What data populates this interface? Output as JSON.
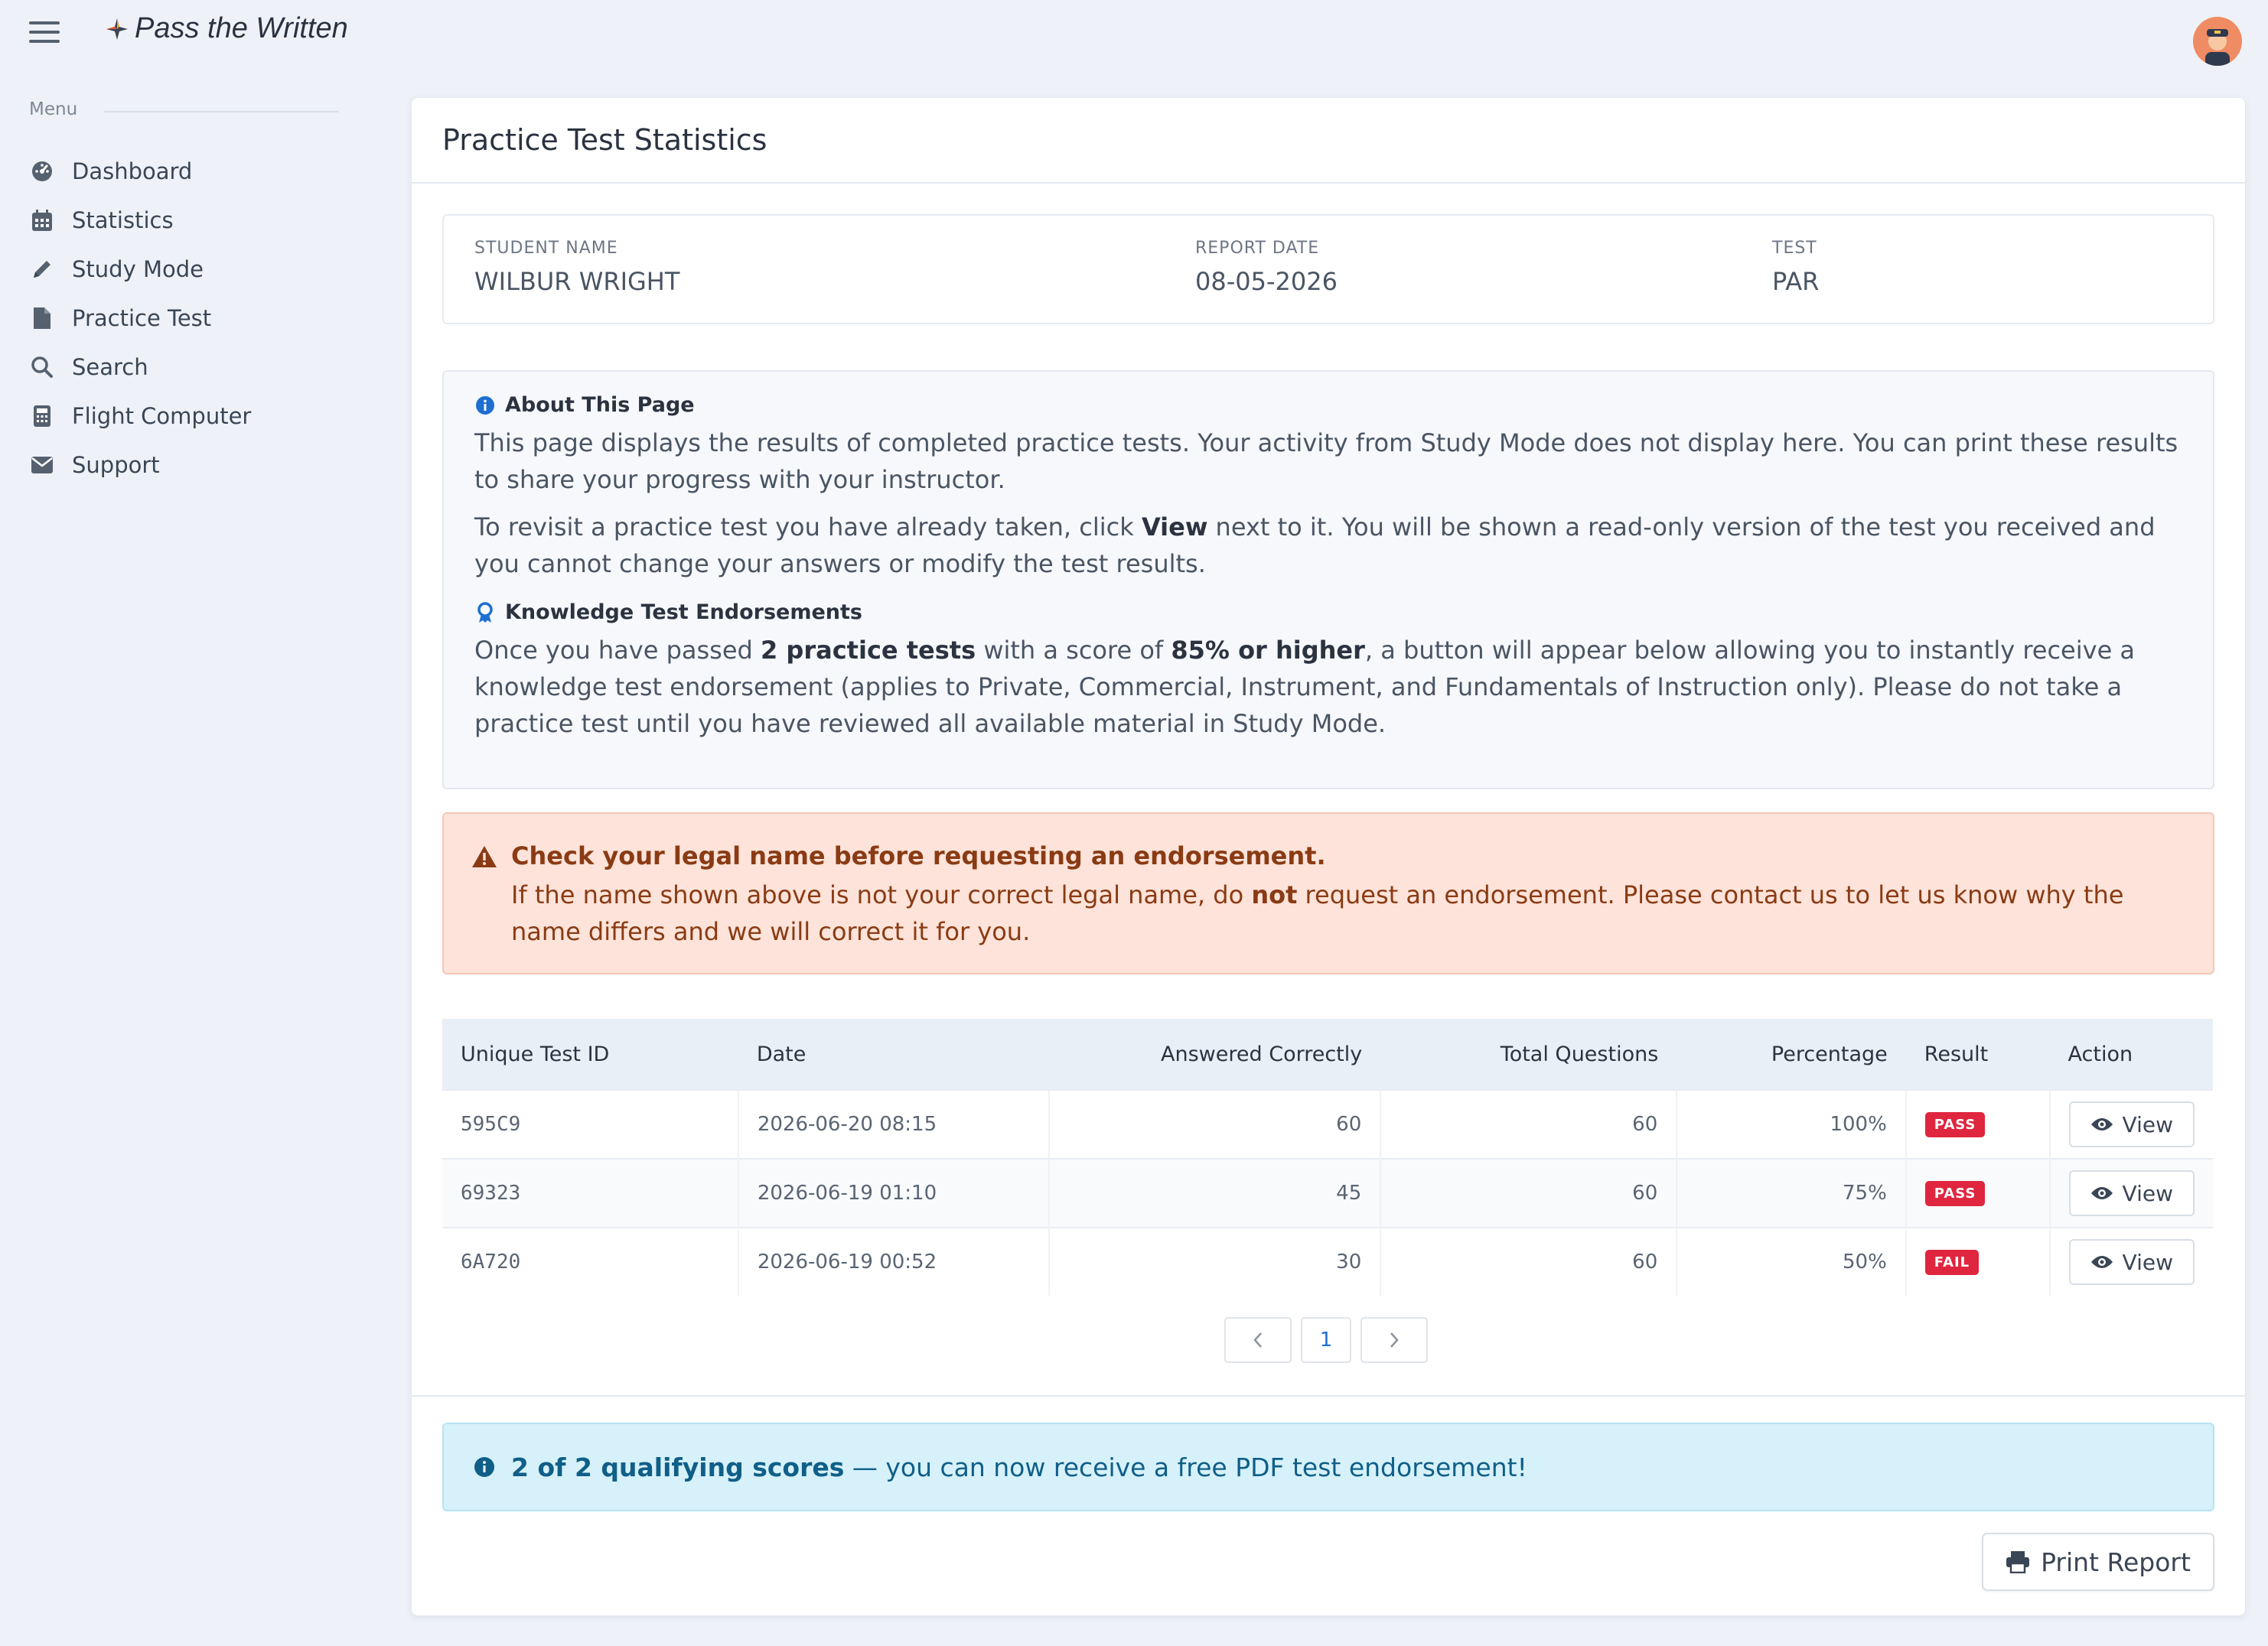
{
  "header": {
    "app_title": "Pass the Written"
  },
  "sidebar": {
    "section_label": "Menu",
    "items": [
      {
        "label": "Dashboard",
        "icon": "dashboard-icon"
      },
      {
        "label": "Statistics",
        "icon": "calendar-icon"
      },
      {
        "label": "Study Mode",
        "icon": "pencil-icon"
      },
      {
        "label": "Practice Test",
        "icon": "file-icon"
      },
      {
        "label": "Search",
        "icon": "search-icon"
      },
      {
        "label": "Flight Computer",
        "icon": "calculator-icon"
      },
      {
        "label": "Support",
        "icon": "envelope-icon"
      }
    ]
  },
  "page": {
    "title": "Practice Test Statistics"
  },
  "student": {
    "name_label": "STUDENT NAME",
    "name": "WILBUR WRIGHT",
    "date_label": "REPORT DATE",
    "date": "08-05-2026",
    "test_label": "TEST",
    "test": "PAR"
  },
  "about": {
    "heading": "About This Page",
    "p1": "This page displays the results of completed practice tests. Your activity from Study Mode does not display here. You can print these results to share your progress with your instructor.",
    "p2_a": "To revisit a practice test you have already taken, click ",
    "p2_b": "View",
    "p2_c": " next to it. You will be shown a read-only version of the test you received and you cannot change your answers or modify the test results.",
    "endorse_heading": "Knowledge Test Endorsements",
    "p3_a": "Once you have passed ",
    "p3_b": "2 practice tests",
    "p3_c": " with a score of ",
    "p3_d": "85% or higher",
    "p3_e": ", a button will appear below allowing you to instantly receive a knowledge test endorsement (applies to Private, Commercial, Instrument, and Fundamentals of Instruction only). Please do not take a practice test until you have reviewed all available material in Study Mode."
  },
  "warning": {
    "title": "Check your legal name before requesting an endorsement.",
    "body_a": "If the name shown above is not your correct legal name, do ",
    "body_b": "not",
    "body_c": " request an endorsement. Please contact us to let us know why the name differs and we will correct it for you."
  },
  "table": {
    "headers": [
      "Unique Test ID",
      "Date",
      "Answered Correctly",
      "Total Questions",
      "Percentage",
      "Result",
      "Action"
    ],
    "rows": [
      {
        "id": "595C9",
        "date": "2026-06-20 08:15",
        "correct": "60",
        "total": "60",
        "pct": "100%",
        "result": "PASS",
        "action": "View"
      },
      {
        "id": "69323",
        "date": "2026-06-19 01:10",
        "correct": "45",
        "total": "60",
        "pct": "75%",
        "result": "PASS",
        "action": "View"
      },
      {
        "id": "6A720",
        "date": "2026-06-19 00:52",
        "correct": "30",
        "total": "60",
        "pct": "50%",
        "result": "FAIL",
        "action": "View"
      }
    ]
  },
  "pagination": {
    "current": "1"
  },
  "qualifying": {
    "bold": "2 of 2 qualifying scores",
    "rest": " — you can now receive a free PDF test endorsement!"
  },
  "actions": {
    "print_label": "Print Report"
  },
  "colors": {
    "background": "#eef2f8",
    "fail_pass_badge": "#e0263f",
    "warning_bg": "#fde3d9",
    "info_bg": "#d6f1fa",
    "accent_blue": "#1f6fd1"
  }
}
